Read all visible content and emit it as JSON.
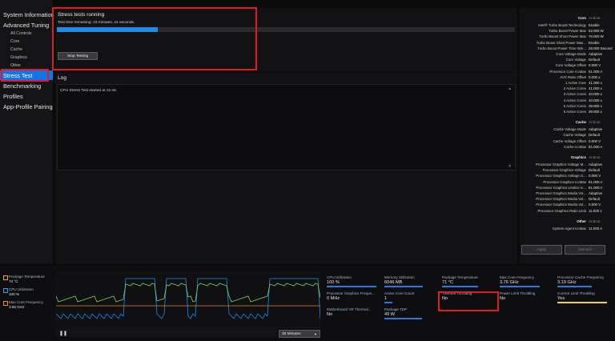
{
  "sidebar": {
    "items": [
      {
        "label": "System Information",
        "level": 1
      },
      {
        "label": "Advanced Tuning",
        "level": 1
      },
      {
        "label": "All Controls",
        "level": 2
      },
      {
        "label": "Core",
        "level": 2
      },
      {
        "label": "Cache",
        "level": 2
      },
      {
        "label": "Graphics",
        "level": 2
      },
      {
        "label": "Other",
        "level": 2
      },
      {
        "label": "Stress Test",
        "level": 1,
        "active": true
      },
      {
        "label": "Benchmarking",
        "level": 1
      },
      {
        "label": "Profiles",
        "level": 1
      },
      {
        "label": "App-Profile Pairing",
        "level": 1
      }
    ]
  },
  "stress": {
    "title": "Stress tests running",
    "remaining": "Test time remaining:  23 minutes, 24 seconds.",
    "progress": 0.22,
    "stop_label": "Stop Testing"
  },
  "log": {
    "title": "Log",
    "lines": [
      "CPU Stress Test started at 12:46."
    ]
  },
  "right_panel": {
    "sections": [
      {
        "header": "Core",
        "header_val": "At Boot",
        "rows": [
          [
            "Intel® Turbo Boost Technology",
            "Enable"
          ],
          [
            "Turbo Boost Power Max",
            "52.000 W"
          ],
          [
            "Turbo Boost Short Power Max",
            "70.000 W"
          ],
          [
            "Turbo Boost Short Power Max...",
            "Enable"
          ],
          [
            "Turbo Boost Power Time Win...",
            "28.000 Second"
          ],
          [
            "Core Voltage Mode",
            "Adaptive"
          ],
          [
            "Core Voltage",
            "Default"
          ],
          [
            "Core Voltage Offset",
            "0.000 V"
          ],
          [
            "Processor Core IccMax",
            "81.000 A"
          ],
          [
            "AVX Ratio Offset",
            "0.000 x"
          ],
          [
            "1 Active Core",
            "41.000 x"
          ],
          [
            "2 Active Cores",
            "41.000 x"
          ],
          [
            "3 Active Cores",
            "40.000 x"
          ],
          [
            "4 Active Cores",
            "40.000 x"
          ],
          [
            "5 Active Cores",
            "39.000 x"
          ],
          [
            "6 Active Cores",
            "39.000 x"
          ]
        ]
      },
      {
        "header": "Cache",
        "header_val": "At Boot",
        "rows": [
          [
            "Cache Voltage Mode",
            "Adaptive"
          ],
          [
            "Cache Voltage",
            "Default"
          ],
          [
            "Cache Voltage Offset",
            "0.000 V"
          ],
          [
            "Cache IccMax",
            "81.000 A"
          ]
        ]
      },
      {
        "header": "Graphics",
        "header_val": "At Boot",
        "rows": [
          [
            "Processor Graphics Voltage M...",
            "Adaptive"
          ],
          [
            "Processor Graphics Voltage",
            "Default"
          ],
          [
            "Processor Graphics Voltage O...",
            "0.000 V"
          ],
          [
            "Processor Graphics IccMax",
            "81.000 A"
          ],
          [
            "Processor Graphics Unslice Ic...",
            "81.000 A"
          ],
          [
            "Processor Graphics Media Vol...",
            "Adaptive"
          ],
          [
            "Processor Graphics Media Vol...",
            "Default"
          ],
          [
            "Processor Graphics Media Vol...",
            "0.000 V"
          ],
          [
            "Processor Graphics Ratio Limit",
            "11.000 x"
          ]
        ]
      },
      {
        "header": "Other",
        "header_val": "At Boot",
        "rows": [
          [
            "System Agent IccMax",
            "11.000 A"
          ]
        ]
      }
    ],
    "apply_label": "Apply",
    "discard_label": "Discard"
  },
  "legend": [
    {
      "label": "Package Temperature",
      "value": "74 °C",
      "color": "#f2a23a"
    },
    {
      "label": "CPU Utilization",
      "value": "100 %",
      "color": "#3aa0f2"
    },
    {
      "label": "Max Core Frequency",
      "value": "3.66 GHz",
      "color": "#f28a3a"
    }
  ],
  "chart_controls": {
    "pause_icon": "pause-icon",
    "range": "30 Minutes"
  },
  "metrics": [
    {
      "label": "CPU Utilization",
      "value": "100 %",
      "fill": 1.0
    },
    {
      "label": "Memory Utilization",
      "value": "6046  MB",
      "fill": 0.78
    },
    {
      "label": "Package Temperature",
      "value": "71 °C",
      "fill": 0.72
    },
    {
      "label": "Max Core Frequency",
      "value": "3.76 GHz",
      "fill": 0.8
    },
    {
      "label": "Processor Cache Frequency",
      "value": "3.19 GHz",
      "fill": 0.7
    },
    {
      "label": "Processor Graphics Freque...",
      "value": "0 MHz",
      "fill": 0
    },
    {
      "label": "Active Core Count",
      "value": "1",
      "fill": 0.16
    },
    {
      "label": "Thermal Throttling",
      "value": "No",
      "fill": 0
    },
    {
      "label": "Power Limit Throttling",
      "value": "No",
      "fill": 0
    },
    {
      "label": "Current Limit Throttling",
      "value": "Yes",
      "fill": 1.0,
      "accent": "#f2d23a"
    },
    {
      "label": "Motherboard VR Thermal...",
      "value": "No",
      "fill": 0
    },
    {
      "label": "Package TDP",
      "value": "49 W",
      "fill": 0.75
    }
  ],
  "colors": {
    "accent": "#1473e6",
    "highlight": "#e21b23"
  }
}
